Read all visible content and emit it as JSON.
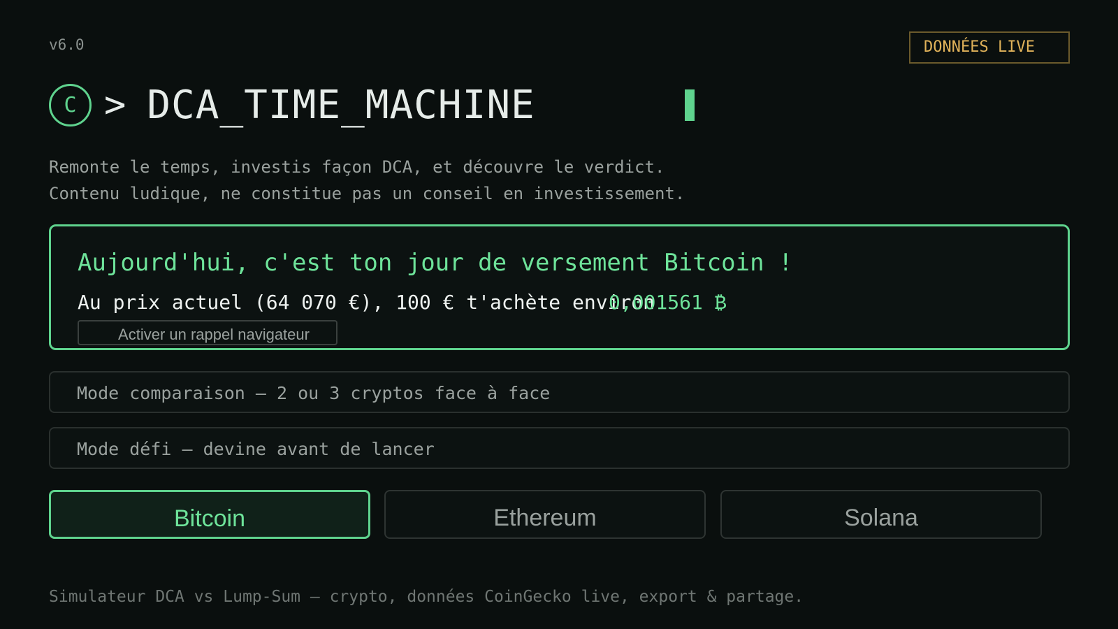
{
  "header": {
    "version": "v6.0",
    "live_badge": "DONNÉES LIVE",
    "logo_letter": "C",
    "prompt": ">",
    "title": "DCA_TIME_MACHINE",
    "subtitle_line1": "Remonte le temps, investis façon DCA, et découvre le verdict.",
    "subtitle_line2": "Contenu ludique, ne constitue pas un conseil en investissement."
  },
  "today_card": {
    "title": "Aujourd'hui, c'est ton jour de versement Bitcoin !",
    "line": "Au prix actuel (64 070 €), 100 € t'achète environ",
    "amount": "0,001561 ₿",
    "reminder_button": "Activer un rappel navigateur"
  },
  "modes": {
    "compare": "Mode comparaison — 2 ou 3 cryptos face à face",
    "defi": "Mode défi — devine avant de lancer"
  },
  "cryptos": [
    {
      "label": "Bitcoin",
      "selected": true
    },
    {
      "label": "Ethereum",
      "selected": false
    },
    {
      "label": "Solana",
      "selected": false
    }
  ],
  "footer": "Simulateur DCA vs Lump-Sum — crypto, données CoinGecko live, export & partage.",
  "colors": {
    "background": "#0a0f0e",
    "accent": "#5fd38e",
    "badge": "#e0b25a"
  }
}
